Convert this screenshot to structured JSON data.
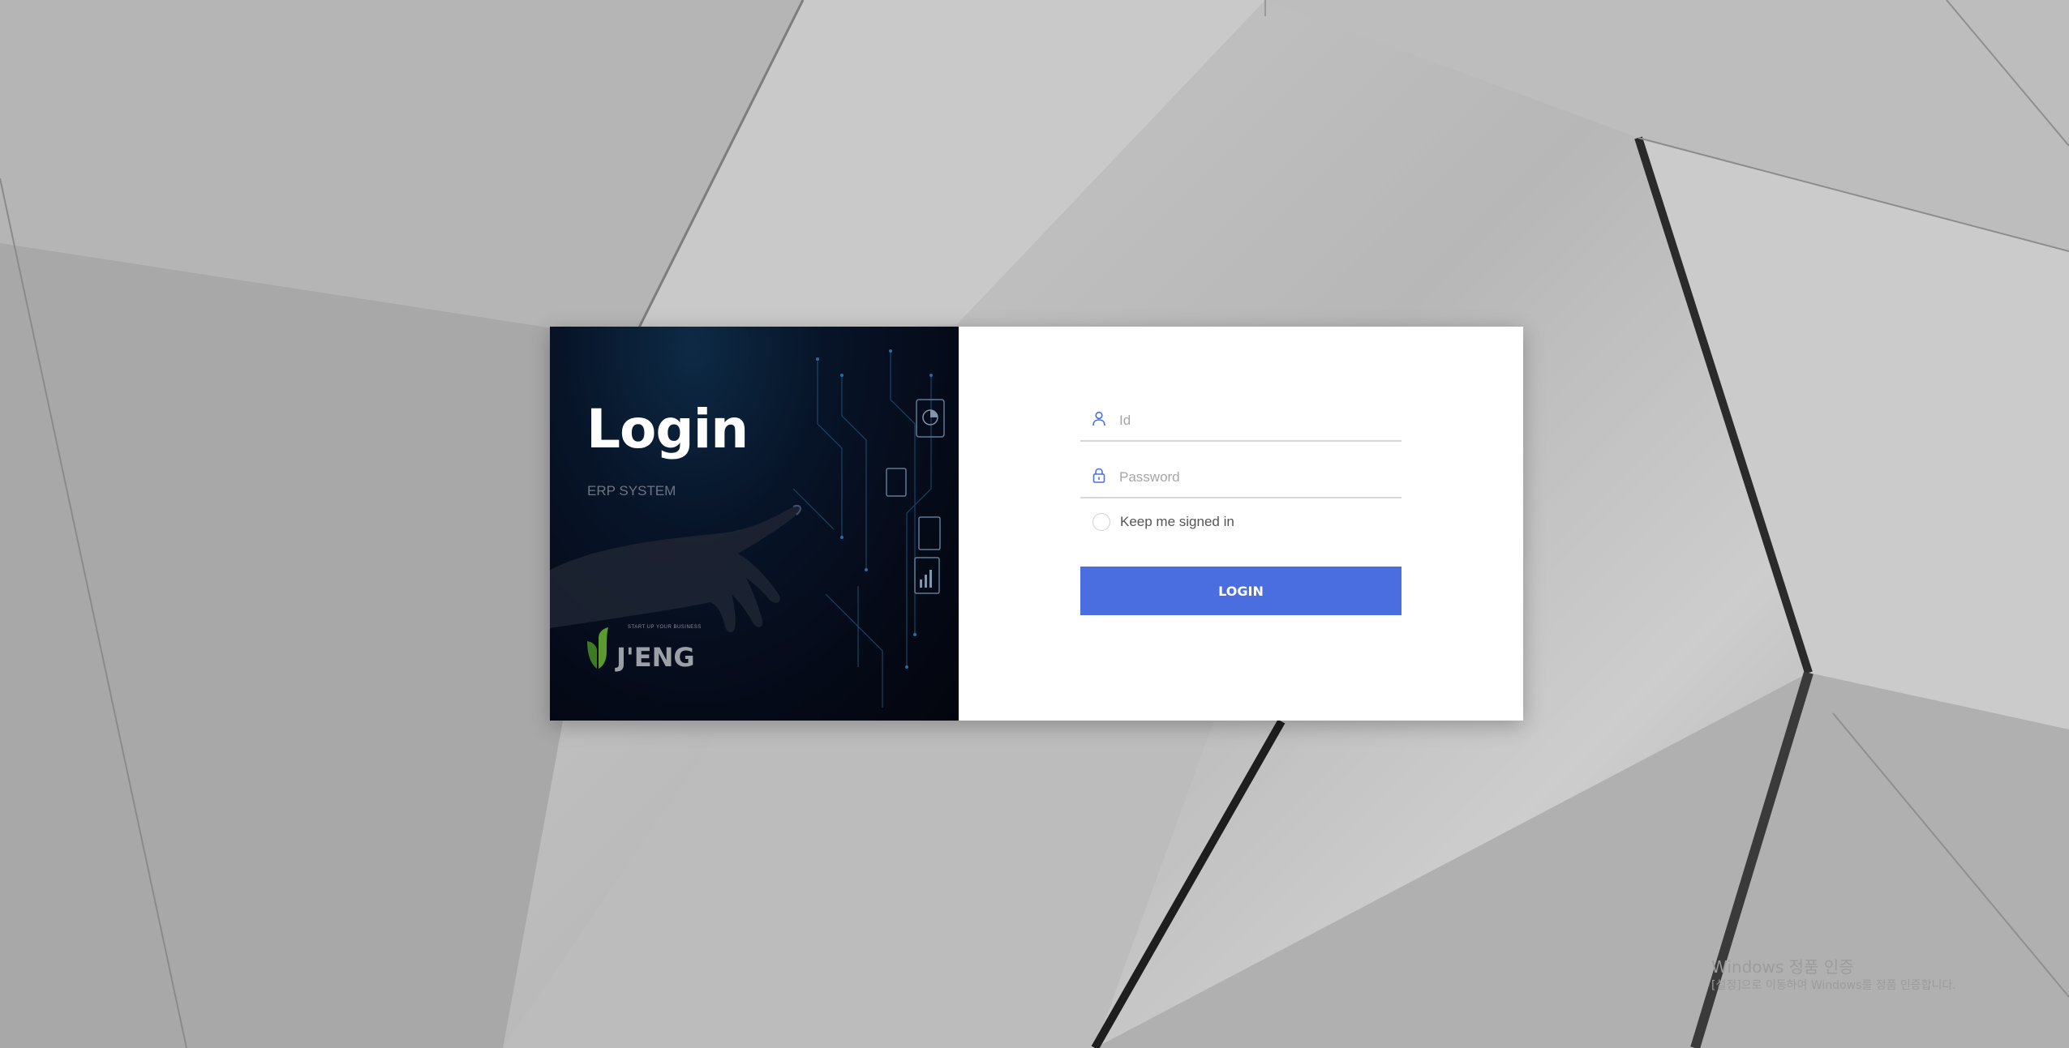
{
  "login_panel": {
    "title": "Login",
    "subtitle": "ERP SYSTEM",
    "logo_text": "J'ENG",
    "logo_tagline": "START UP YOUR BUSINESS",
    "logo_color": "#4b8a2a"
  },
  "form": {
    "id_placeholder": "Id",
    "password_placeholder": "Password",
    "remember_label": "Keep me signed in",
    "submit_label": "LOGIN",
    "accent_color": "#4a6ee0",
    "icons": {
      "id": "user-icon",
      "password": "lock-icon"
    }
  },
  "os_watermark": {
    "title": "Windows 정품 인증",
    "subtitle": "[설정]으로 이동하여 Windows를 정품 인증합니다."
  }
}
